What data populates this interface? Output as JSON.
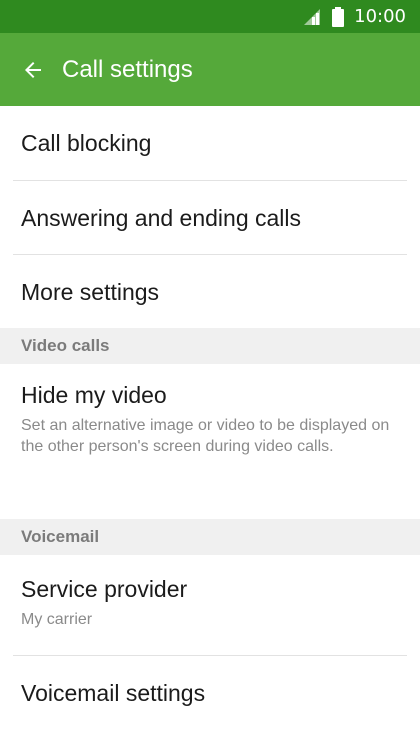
{
  "status_bar": {
    "time": "10:00",
    "icons": [
      "signal-icon",
      "battery-icon"
    ]
  },
  "app_bar": {
    "title": "Call settings",
    "back_icon": "arrow-back-icon"
  },
  "items": [
    {
      "label": "Call blocking"
    },
    {
      "label": "Answering and ending calls"
    },
    {
      "label": "More settings"
    }
  ],
  "sections": [
    {
      "header": "Video calls",
      "items": [
        {
          "label": "Hide my video",
          "summary": "Set an alternative image or video to be displayed on the other person's screen during video calls."
        }
      ]
    },
    {
      "header": "Voicemail",
      "items": [
        {
          "label": "Service provider",
          "summary": "My carrier"
        },
        {
          "label": "Voicemail settings"
        }
      ]
    }
  ],
  "colors": {
    "status_bar": "#2f8a1f",
    "app_bar": "#55a93a",
    "section_background": "#f0f0f0"
  }
}
